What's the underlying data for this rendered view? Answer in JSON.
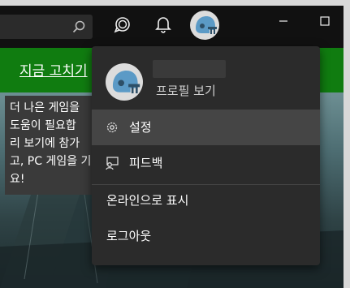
{
  "search": {
    "icon": "search-icon"
  },
  "titlebar": {
    "icons": [
      "chat-icon",
      "bell-icon",
      "avatar",
      "minimize-icon",
      "maximize-icon"
    ]
  },
  "banner": {
    "link_text": "지금 고치기"
  },
  "promo": {
    "lines": [
      "더 나은 게임을",
      "도움이 필요합",
      "리 보기에 참가",
      "고, PC 게임을 기",
      "요!"
    ]
  },
  "menu": {
    "profile_name": "",
    "profile_link": "프로필 보기",
    "items": [
      {
        "label": "설정",
        "icon": "gear-icon"
      },
      {
        "label": "피드백",
        "icon": "feedback-icon"
      },
      {
        "label": "온라인으로 표시"
      },
      {
        "label": "로그아웃"
      }
    ]
  },
  "colors": {
    "accent_green": "#107c10",
    "menu_bg": "#2b2b2b",
    "menu_hover": "#454545"
  }
}
